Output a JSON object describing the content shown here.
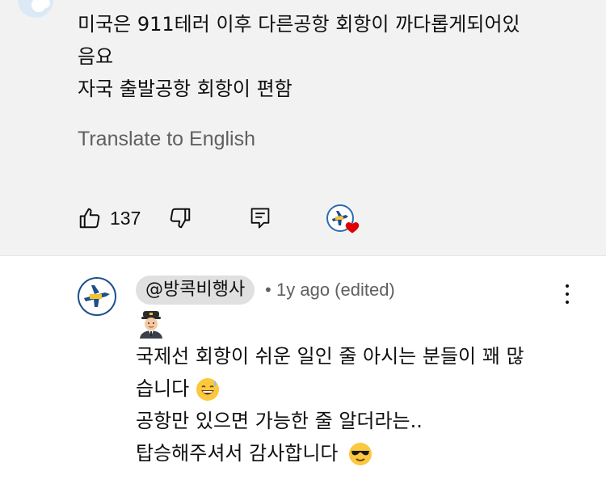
{
  "top_comment": {
    "text_lines": [
      "미국은 911테러 이후 다른공항 회항이 까다롭게되어있",
      "음요",
      "자국 출발공항 회항이 편함"
    ],
    "translate_label": "Translate to English",
    "like_count": "137"
  },
  "reply": {
    "handle": "@방콕비행사",
    "separator": "•",
    "time": "1y ago (edited)",
    "text_lines": [
      "국제선 회항이 쉬운 일인 줄 아시는 분들이 꽤 많",
      "습니다",
      "공항만 있으면 가능한 줄 알더라는..",
      "탑승해주셔서 감사합니다"
    ]
  },
  "icons": [
    "thumbs-up-icon",
    "thumbs-down-icon",
    "reply-icon",
    "creator-heart-icon",
    "more-vert-icon",
    "pilot-emoji",
    "sweat-smile-emoji",
    "sunglasses-emoji"
  ],
  "colors": {
    "secondary_text": "#606060",
    "heart": "#e00000",
    "highlight_bg": "#f2f2f2",
    "handle_bg": "#e0e0e0"
  }
}
